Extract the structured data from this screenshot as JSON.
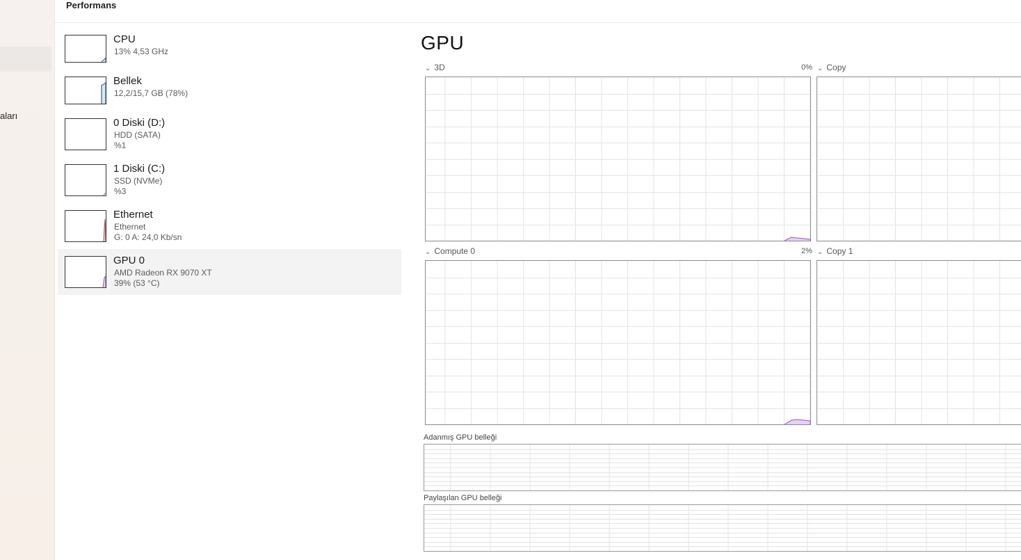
{
  "nav": {
    "partial_label": "aları"
  },
  "header": {
    "title": "Performans"
  },
  "devices": [
    {
      "name": "CPU",
      "line1": "13% 4,53 GHz",
      "line2": ""
    },
    {
      "name": "Bellek",
      "line1": "12,2/15,7 GB (78%)",
      "line2": ""
    },
    {
      "name": "0 Diski (D:)",
      "line1": "HDD (SATA)",
      "line2": "%1"
    },
    {
      "name": "1 Diski (C:)",
      "line1": "SSD (NVMe)",
      "line2": "%3"
    },
    {
      "name": "Ethernet",
      "line1": "Ethernet",
      "line2": "G: 0 A: 24,0 Kb/sn"
    },
    {
      "name": "GPU 0",
      "line1": "AMD Radeon RX 9070 XT",
      "line2": "39% (53 °C)"
    }
  ],
  "main": {
    "title": "GPU",
    "graphs": [
      {
        "label": "3D",
        "percent": "0%"
      },
      {
        "label": "Copy",
        "percent": ""
      },
      {
        "label": "Compute 0",
        "percent": "2%"
      },
      {
        "label": "Copy 1",
        "percent": ""
      }
    ],
    "dedicated_memory_label": "Adanmış GPU belleği",
    "shared_memory_label": "Paylaşılan GPU belleği"
  },
  "colors": {
    "cpu": "#2a7ab8",
    "memory": "#3b87c9",
    "disk": "#4f8f2f",
    "ethernet": "#a64b5a",
    "gpu": "#9b4dd6",
    "grid": "#e4e4e4"
  },
  "icons": {
    "expand": "chevron-down-icon"
  }
}
